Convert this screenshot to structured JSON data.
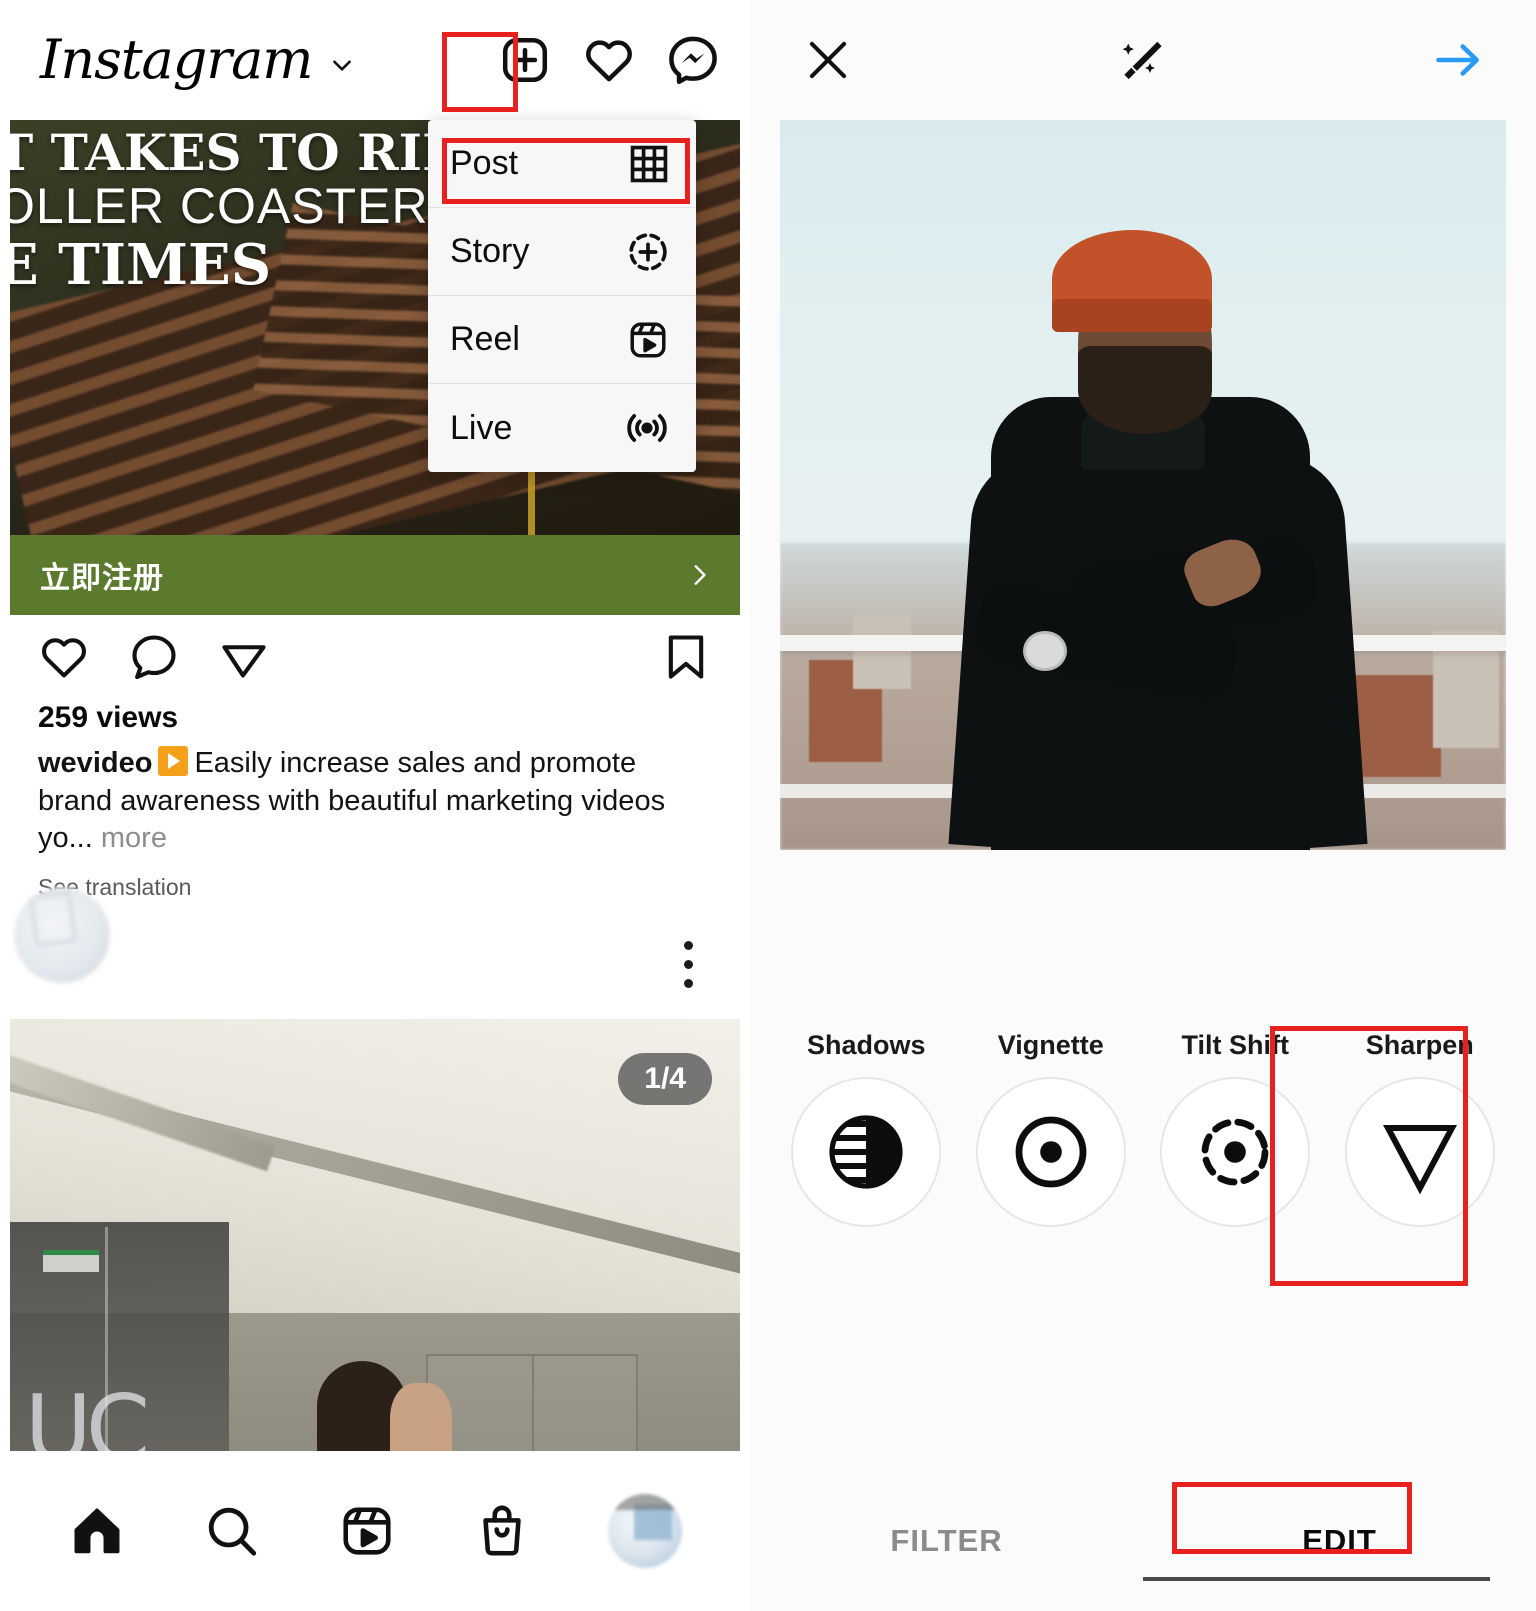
{
  "left_panel": {
    "header": {
      "logo_text": "Instagram",
      "chevron_icon": "chevron-down-icon",
      "icons": [
        {
          "name": "create-new-plus-icon",
          "label": "Create"
        },
        {
          "name": "heart-activity-icon",
          "label": "Activity"
        },
        {
          "name": "messenger-icon",
          "label": "Messenger"
        }
      ]
    },
    "create_menu": {
      "items": [
        {
          "label": "Post",
          "icon": "grid-icon",
          "highlighted": true
        },
        {
          "label": "Story",
          "icon": "story-plus-circle-icon",
          "highlighted": false
        },
        {
          "label": "Reel",
          "icon": "reel-play-icon",
          "highlighted": false
        },
        {
          "label": "Live",
          "icon": "live-broadcast-icon",
          "highlighted": false
        }
      ]
    },
    "feed_post_1": {
      "overlay_lines": [
        "T TAKES TO RIDE",
        "OLLER COASTER",
        "E TIMES"
      ],
      "cta_label": "立即注册",
      "cta_arrow_icon": "chevron-right-icon",
      "actions": [
        {
          "name": "like-icon"
        },
        {
          "name": "comment-icon"
        },
        {
          "name": "share-icon"
        },
        {
          "name": "save-bookmark-icon"
        }
      ],
      "views": "259 views",
      "caption_username": "wevideo",
      "caption_badge_icon": "sponsored-play-icon",
      "caption_text": "Easily increase sales and promote brand awareness with beautiful marketing videos yo...",
      "caption_more": "more",
      "see_translation": "See translation"
    },
    "feed_post_2": {
      "more_options_icon": "three-dots-vertical-icon",
      "avatar_icon": "avatar",
      "carousel_badge": "1/4"
    },
    "bottom_nav": [
      {
        "name": "home-icon",
        "label": "Home",
        "active": true
      },
      {
        "name": "search-icon",
        "label": "Search",
        "active": false
      },
      {
        "name": "reels-icon",
        "label": "Reels",
        "active": false
      },
      {
        "name": "shop-bag-icon",
        "label": "Shop",
        "active": false
      },
      {
        "name": "profile-avatar",
        "label": "Profile",
        "active": false
      }
    ]
  },
  "right_panel": {
    "header": {
      "close_label": "close-icon",
      "magic_label": "magic-wand-icon",
      "next_label": "next-arrow-icon",
      "next_color": "#2a9bf2"
    },
    "photo_alt": "Man in orange beanie and black turtleneck on a rooftop",
    "tools": [
      {
        "label": "Shadows",
        "icon": "shadows-icon",
        "highlighted": false
      },
      {
        "label": "Vignette",
        "icon": "vignette-icon",
        "highlighted": false
      },
      {
        "label": "Tilt Shift",
        "icon": "tilt-shift-icon",
        "highlighted": false
      },
      {
        "label": "Sharpen",
        "icon": "sharpen-triangle-icon",
        "highlighted": true
      }
    ],
    "tabs": [
      {
        "label": "FILTER",
        "active": false,
        "highlighted": false
      },
      {
        "label": "EDIT",
        "active": true,
        "highlighted": true
      }
    ]
  },
  "annotations": {
    "highlight_color": "#e8201e",
    "boxes": [
      {
        "name": "create-button-highlight"
      },
      {
        "name": "post-menu-item-highlight"
      },
      {
        "name": "sharpen-tool-highlight"
      },
      {
        "name": "edit-tab-highlight"
      }
    ]
  }
}
